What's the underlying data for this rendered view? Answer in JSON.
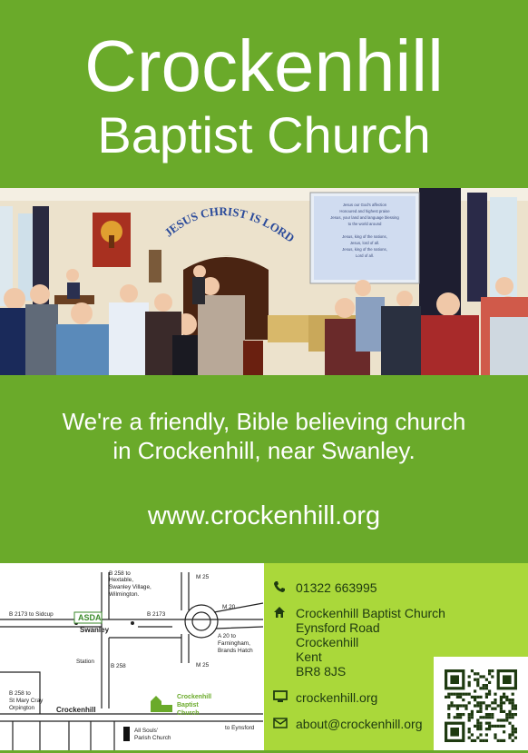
{
  "header": {
    "line1": "Crockenhill",
    "line2": "Baptist Church"
  },
  "photo": {
    "banner_text": "JESUS CHRIST IS LORD",
    "screen_lines": [
      "Jesus our God's affection",
      "Honoured and highest praise",
      "Jesus, your land and language blessing",
      "to the world around",
      "",
      "Jesus, king of the nations,",
      "Jesus, lord of all.",
      "Jesus, king of the nations,",
      "Lord of all."
    ]
  },
  "tagline": {
    "line1": "We're a friendly, Bible believing church",
    "line2": "in Crockenhill, near Swanley."
  },
  "website": "www.crockenhill.org",
  "map": {
    "labels": {
      "b258_top": "B 258 to",
      "hextable": "Hextable,",
      "swanley_village": "Swanley Village,",
      "wilmington": "Wilmington.",
      "m25_top": "M 25",
      "m20": "M 20",
      "b2173_sidcup": "B 2173 to Sidcup",
      "asda": "ASDA",
      "b2173": "B 2173",
      "swanley": "Swanley",
      "a20_to": "A 20 to",
      "farningham": "Farningham,",
      "brands_hatch": "Brands Hatch",
      "station": "Station",
      "b258": "B 258",
      "m25_bottom": "M 25",
      "b258_to": "B 258 to",
      "st_mary_cray": "St Mary Cray",
      "orpington": "Orpington",
      "crockenhill": "Crockenhill",
      "church1": "Crockenhill",
      "church2": "Baptist",
      "church3": "Church",
      "all_souls1": "All Souls'",
      "all_souls2": "Parish Church",
      "to_eynsford": "to Eynsford"
    }
  },
  "contact": {
    "phone": "01322 663995",
    "address": [
      "Crockenhill Baptist Church",
      "Eynsford Road",
      "Crockenhill",
      "Kent",
      "BR8 8JS"
    ],
    "web": "crockenhill.org",
    "email": "about@crockenhill.org"
  },
  "colors": {
    "brand_green": "#6aaa2a",
    "light_green": "#aad83a",
    "text_dark": "#1e3a10"
  },
  "icons": {
    "phone": "phone-icon",
    "home": "home-icon",
    "web": "monitor-icon",
    "email": "envelope-icon",
    "qr": "qr-code"
  }
}
